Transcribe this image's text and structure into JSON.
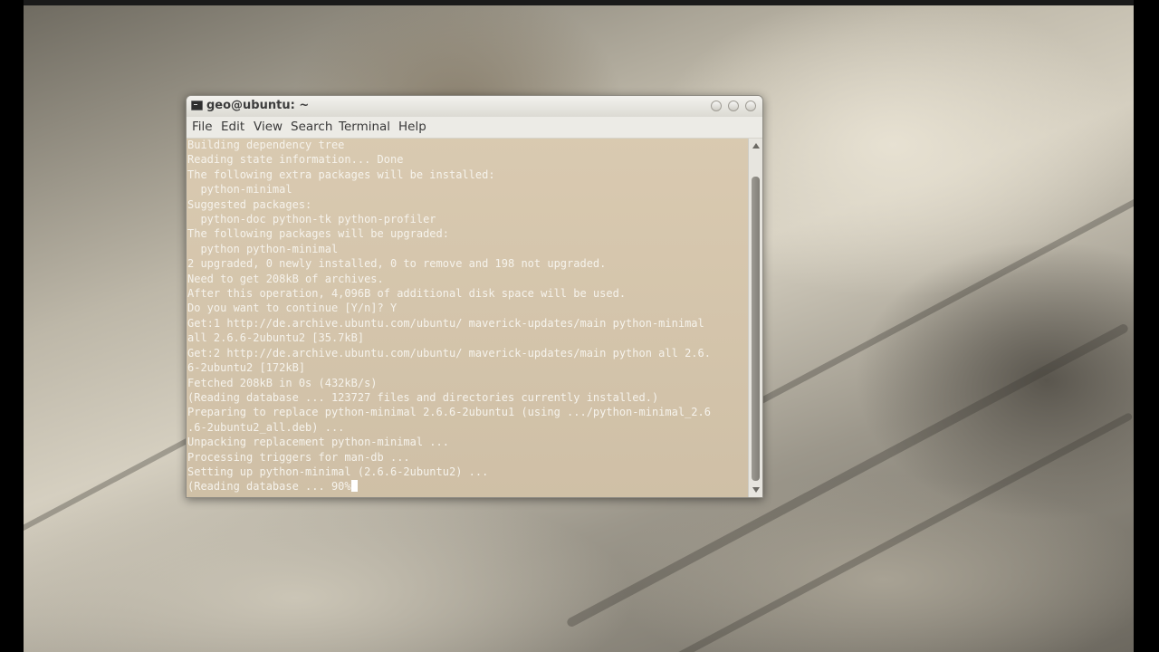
{
  "window": {
    "title": "geo@ubuntu: ~",
    "buttons": [
      "minimize",
      "maximize",
      "close"
    ]
  },
  "menubar": {
    "items": [
      "File",
      "Edit",
      "View",
      "Search",
      "Terminal",
      "Help"
    ]
  },
  "terminal": {
    "lines": [
      "Building dependency tree",
      "Reading state information... Done",
      "The following extra packages will be installed:",
      "  python-minimal",
      "Suggested packages:",
      "  python-doc python-tk python-profiler",
      "The following packages will be upgraded:",
      "  python python-minimal",
      "2 upgraded, 0 newly installed, 0 to remove and 198 not upgraded.",
      "Need to get 208kB of archives.",
      "After this operation, 4,096B of additional disk space will be used.",
      "Do you want to continue [Y/n]? Y",
      "Get:1 http://de.archive.ubuntu.com/ubuntu/ maverick-updates/main python-minimal",
      "all 2.6.6-2ubuntu2 [35.7kB]",
      "Get:2 http://de.archive.ubuntu.com/ubuntu/ maverick-updates/main python all 2.6.",
      "6-2ubuntu2 [172kB]",
      "Fetched 208kB in 0s (432kB/s)",
      "(Reading database ... 123727 files and directories currently installed.)",
      "Preparing to replace python-minimal 2.6.6-2ubuntu1 (using .../python-minimal_2.6",
      ".6-2ubuntu2_all.deb) ...",
      "Unpacking replacement python-minimal ...",
      "Processing triggers for man-db ...",
      "Setting up python-minimal (2.6.6-2ubuntu2) ...",
      "(Reading database ... 90%"
    ]
  },
  "colors": {
    "terminal_bg": "#d4c6ad",
    "terminal_fg": "#f6f3ec",
    "titlebar": "#e8e6e0"
  },
  "icons": {
    "window": "terminal-icon"
  }
}
